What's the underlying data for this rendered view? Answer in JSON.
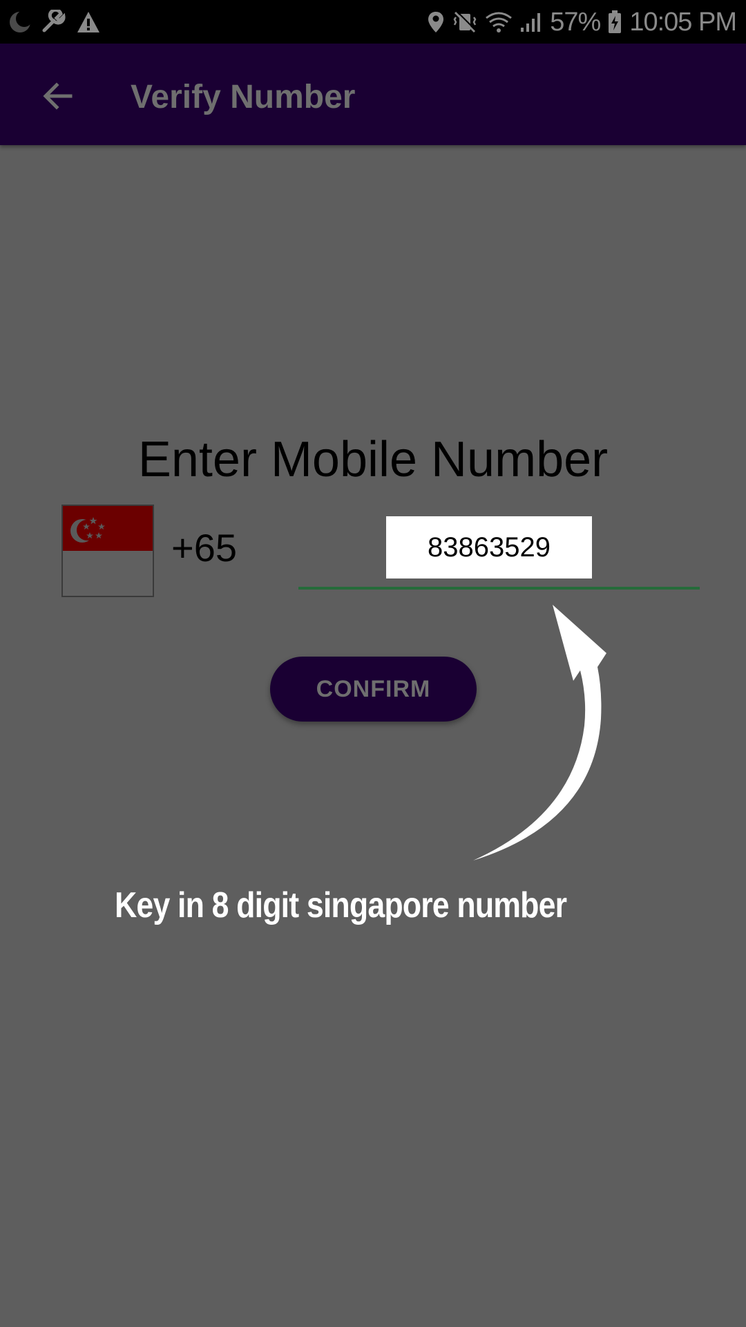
{
  "status_bar": {
    "battery_percent": "57%",
    "time": "10:05 PM",
    "icons": [
      "moon-icon",
      "wrench-icon",
      "warning-icon",
      "location-icon",
      "vibrate-mute-icon",
      "wifi-icon",
      "signal-icon",
      "battery-icon"
    ]
  },
  "app_bar": {
    "back_icon": "arrow-left-icon",
    "title": "Verify Number",
    "background": "#1a0033"
  },
  "form": {
    "heading": "Enter Mobile Number",
    "country_flag": "singapore-flag-icon",
    "country_code": "+65",
    "phone_value": "83863529",
    "confirm_label": "CONFIRM",
    "field_underline_color": "#256b3a"
  },
  "overlay": {
    "hint": "Key in 8 digit singapore number",
    "arrow_icon": "curved-arrow-icon"
  },
  "colors": {
    "scrim": "#5e5e5e",
    "primary_dark": "#1a0033",
    "flag_red": "#6b0000"
  }
}
